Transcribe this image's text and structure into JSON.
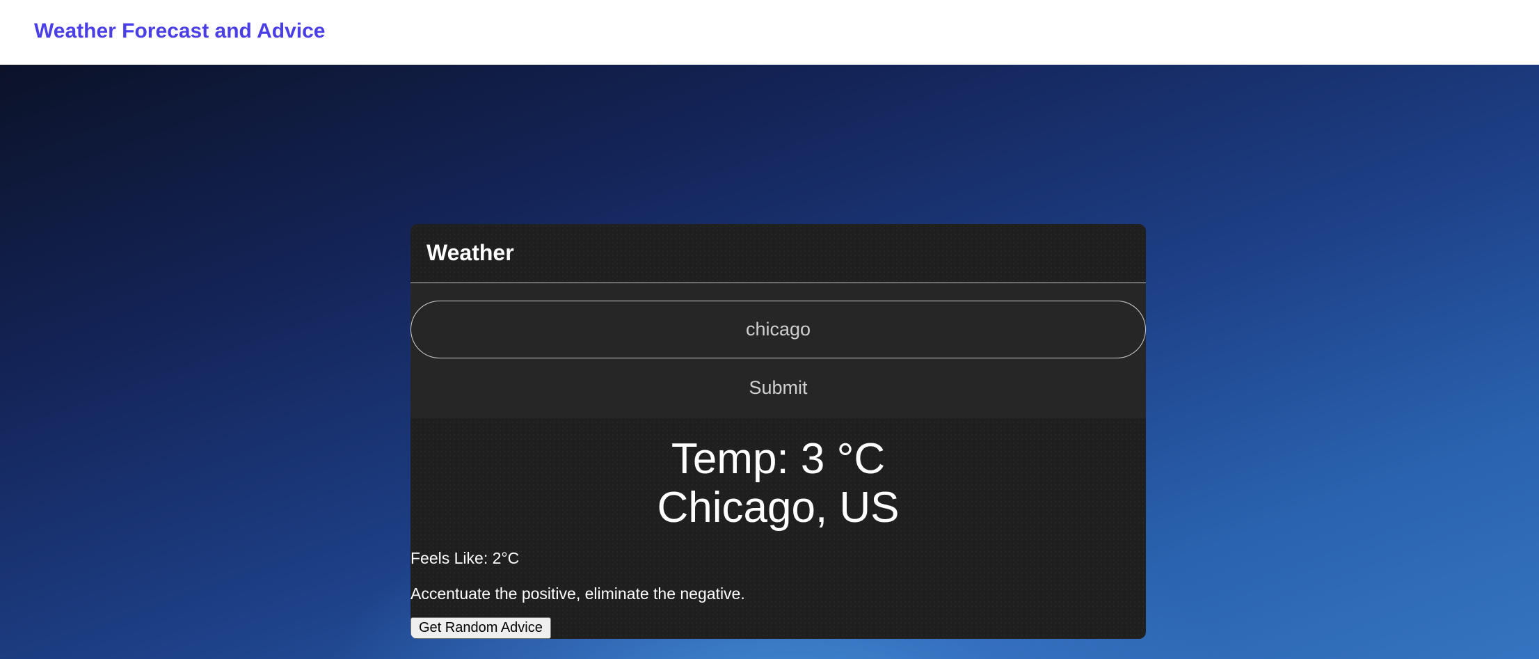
{
  "navbar": {
    "brand": "Weather Forecast and Advice"
  },
  "weather_card": {
    "title": "Weather",
    "search": {
      "value": "chicago",
      "placeholder": ""
    },
    "submit_label": "Submit",
    "temp_text": "Temp: 3 °C",
    "location_text": "Chicago, US",
    "feels_like_text": "Feels Like: 2°C",
    "advice_text": "Accentuate the positive, eliminate the negative.",
    "advice_button_label": "Get Random Advice"
  },
  "colors": {
    "brand": "#4a3ee6",
    "card_background": "#1f1f1f",
    "text": "#ffffff"
  }
}
